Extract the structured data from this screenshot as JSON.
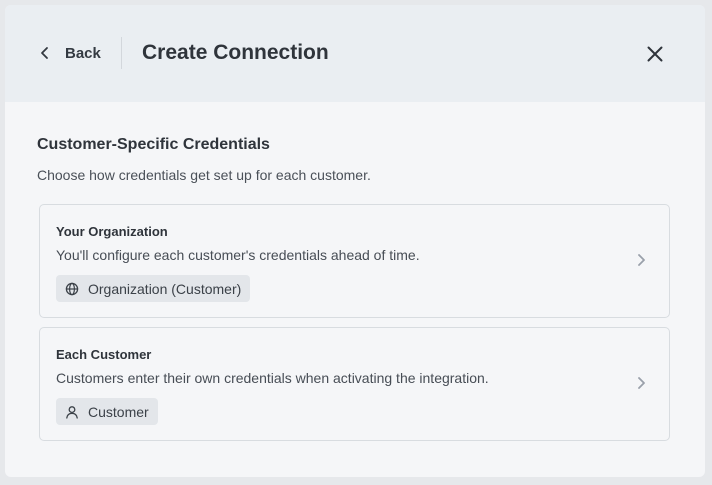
{
  "header": {
    "back_label": "Back",
    "title": "Create Connection",
    "back_icon": "chevron-left-icon",
    "close_icon": "close-icon"
  },
  "section": {
    "title": "Customer-Specific Credentials",
    "subtitle": "Choose how credentials get set up for each customer."
  },
  "options": [
    {
      "title": "Your Organization",
      "description": "You'll configure each customer's credentials ahead of time.",
      "badge_label": "Organization (Customer)",
      "badge_icon": "globe-icon"
    },
    {
      "title": "Each Customer",
      "description": "Customers enter their own credentials when activating the integration.",
      "badge_label": "Customer",
      "badge_icon": "user-icon"
    }
  ],
  "colors": {
    "header_bg": "#eaeef2",
    "modal_bg": "#f5f6f8",
    "text_primary": "#2f343b",
    "badge_bg": "#e3e6ea",
    "chevron": "#9aa0aa"
  }
}
